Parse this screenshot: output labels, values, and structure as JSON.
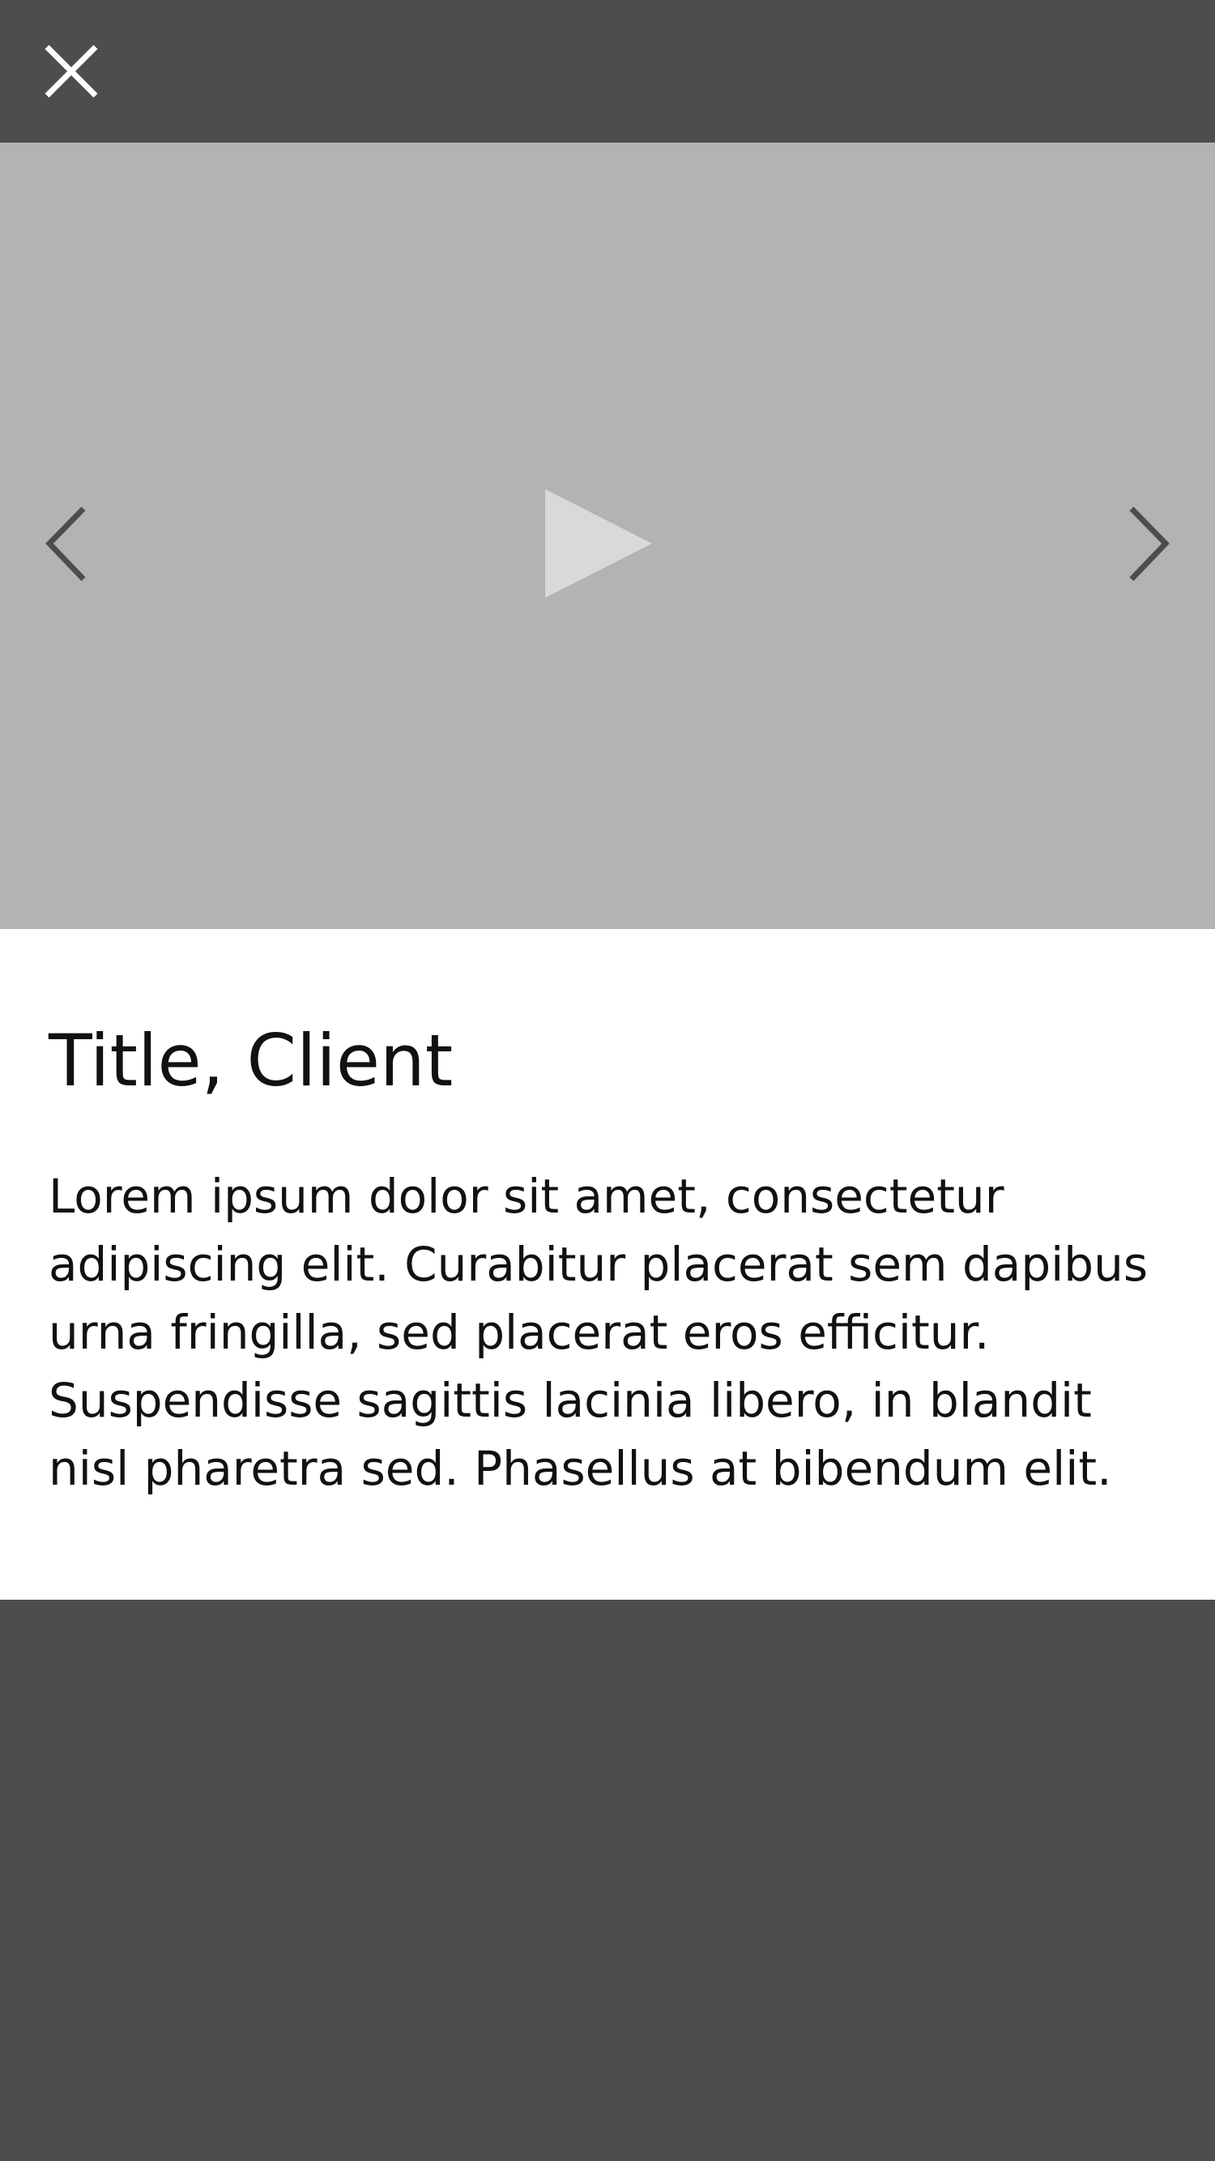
{
  "header": {
    "close_icon": "close-icon"
  },
  "media": {
    "prev_icon": "chevron-left-icon",
    "next_icon": "chevron-right-icon",
    "play_icon": "play-icon"
  },
  "content": {
    "title": "Title, Client",
    "description": "Lorem ipsum dolor sit amet, consectetur adipiscing elit. Curabitur placerat sem dapibus urna fringilla, sed placerat eros efficitur. Suspendisse sagittis lacinia libero, in blandit nisl pharetra sed. Phasellus at bibendum elit."
  },
  "colors": {
    "dark_bar": "#4d4d4d",
    "media_placeholder": "#b3b3b3",
    "play_icon": "#d9d9d9",
    "chevron": "#4d4d4d",
    "close_icon": "#ffffff"
  }
}
